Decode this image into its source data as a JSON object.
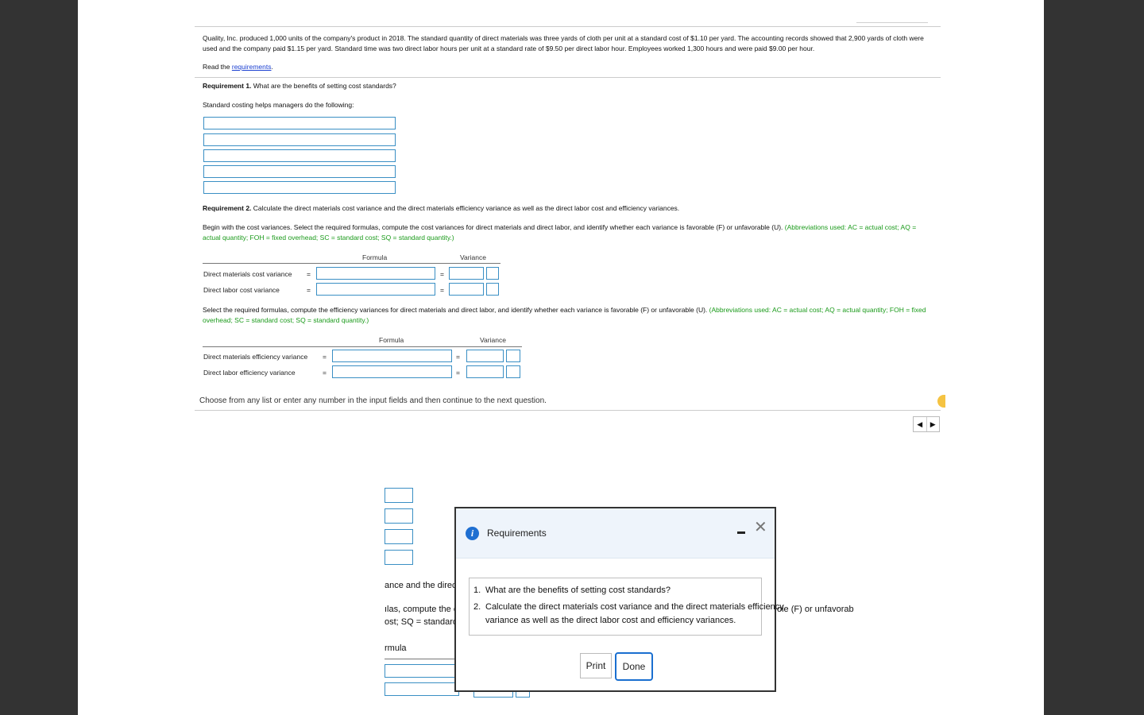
{
  "question": {
    "intro_line1": "Quality, Inc. produced 1,000 units of the company's product in 2018. The standard quantity of direct materials was three yards of cloth per unit at a standard cost of $1.10 per yard. The accounting records showed that 2,900 yards of cloth were",
    "intro_line2": "used and the company paid $1.15 per yard. Standard time was two direct labor hours per unit at a standard rate of $9.50 per direct labor hour. Employees worked 1,300 hours and were paid $9.00 per hour.",
    "read_prefix": "Read the ",
    "read_link": "requirements",
    "read_suffix": "."
  },
  "req1": {
    "label": "Requirement 1.",
    "text": " What are the benefits of setting cost standards?",
    "intro": "Standard costing helps managers do the following:"
  },
  "req2": {
    "label": "Requirement 2.",
    "text": " Calculate the direct materials cost variance and the direct materials efficiency variance as well as the direct labor cost and efficiency variances.",
    "cost_instr": "Begin with the cost variances. Select the required formulas, compute the cost variances for direct materials and direct labor, and identify whether each variance is favorable (F) or unfavorable (U).",
    "abbrev_a1": " (Abbreviations used: AC = actual cost; AQ =",
    "abbrev_a2": "actual quantity; FOH = fixed overhead; SC = standard cost; SQ = standard quantity.)",
    "eff_instr": "Select the required formulas, compute the efficiency variances for direct materials and direct labor, and identify whether each variance is favorable (F) or unfavorable (U).",
    "abbrev_b1": " (Abbreviations used: AC = actual cost; AQ = actual quantity; FOH = fixed",
    "abbrev_b2": "overhead; SC = standard cost; SQ = standard quantity.)"
  },
  "cost_table": {
    "col_formula": "Formula",
    "col_variance": "Variance",
    "rows": [
      {
        "label": "Direct materials cost variance",
        "eq": "=",
        "eq2": "="
      },
      {
        "label": "Direct labor cost variance",
        "eq": "=",
        "eq2": "="
      }
    ]
  },
  "eff_table": {
    "col_formula": "Formula",
    "col_variance": "Variance",
    "rows": [
      {
        "label": "Direct materials efficiency variance",
        "eq": "=",
        "eq2": "="
      },
      {
        "label": "Direct labor efficiency variance",
        "eq": "=",
        "eq2": "="
      }
    ]
  },
  "footer": {
    "hint": "Choose from any list or enter any number in the input fields and then continue to the next question."
  },
  "background_fragments": {
    "frag1": "ance and the direct r",
    "frag2": "ılas, compute the co",
    "frag3": "ost; SQ = standard c",
    "frag4": "rmula",
    "frag5": "ole (F) or unfavorab"
  },
  "modal": {
    "title": "Requirements",
    "items": [
      {
        "num": "1.",
        "text": "What are the benefits of setting cost standards?"
      },
      {
        "num": "2.",
        "text_line1": "Calculate the direct materials cost variance and the direct materials efficiency",
        "text_line2": "variance as well as the direct labor cost and efficiency variances."
      }
    ],
    "print_label": "Print",
    "done_label": "Done"
  }
}
